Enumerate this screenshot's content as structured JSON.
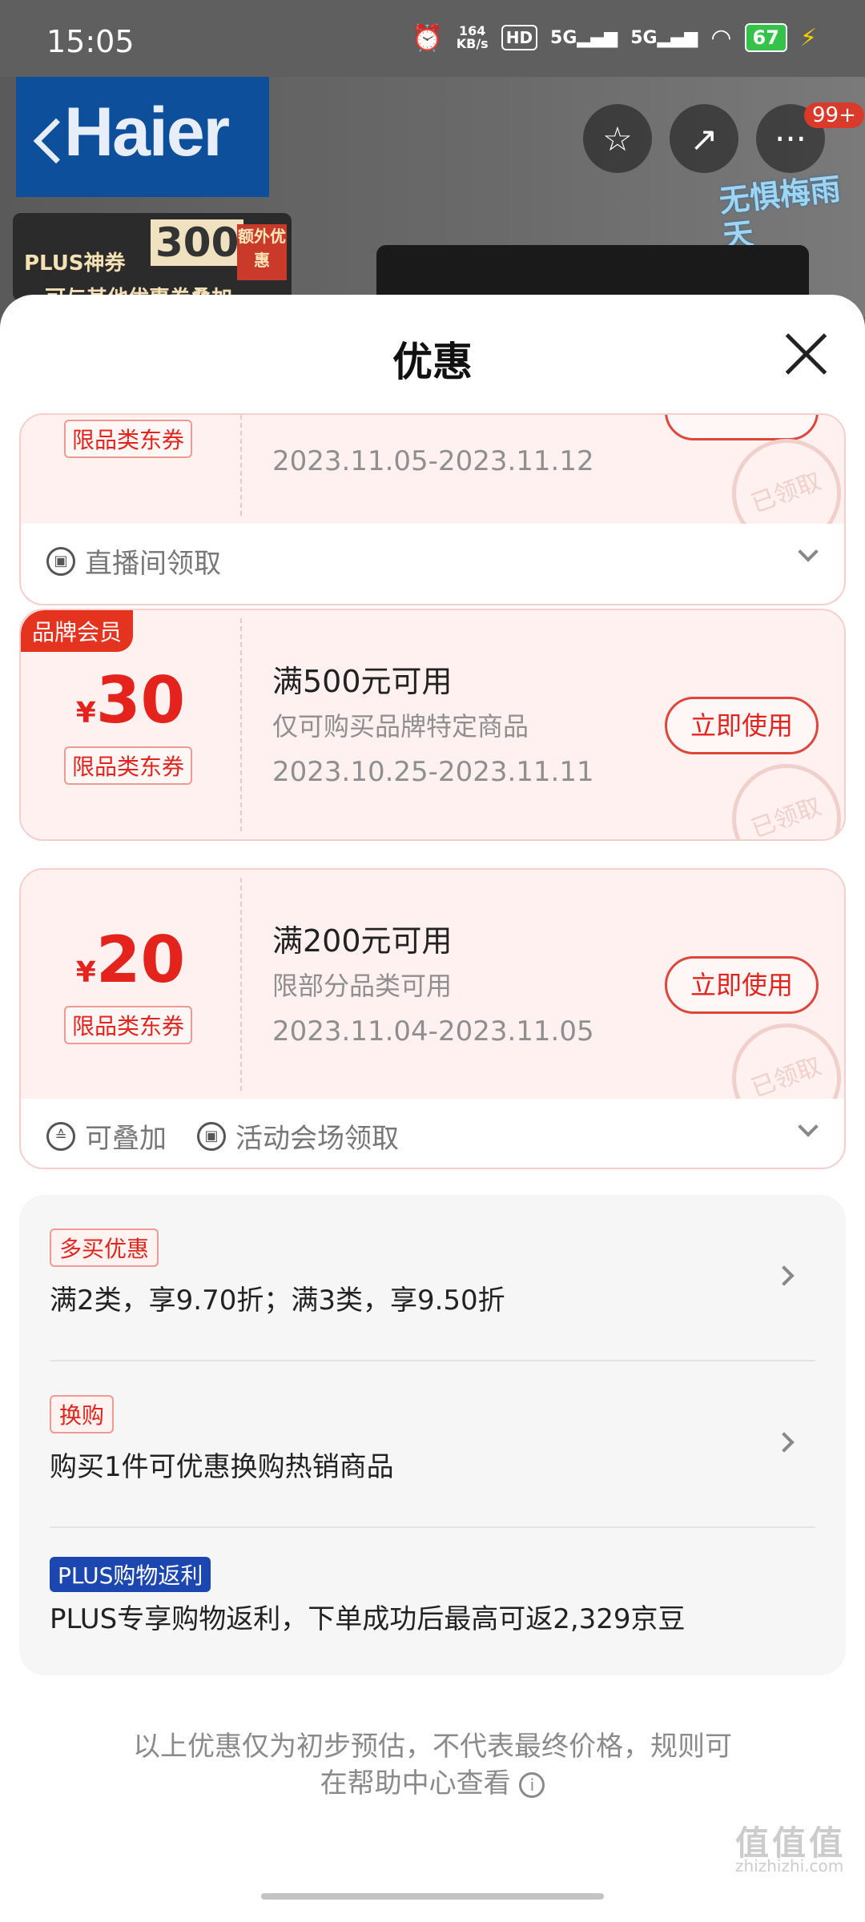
{
  "status_bar": {
    "time": "15:05",
    "net_speed_top": "164",
    "net_speed_bottom": "KB/s",
    "hd_label": "HD",
    "net1": "5G",
    "net2": "5G",
    "battery": "67"
  },
  "banner": {
    "brand": "Haier",
    "plus_label": "PLUS神券",
    "plus_amount": "300",
    "plus_extra": "额外优惠",
    "plus_bottom": "可与其他优惠券叠加",
    "notification_count": "99+",
    "slogan": "无惧梅雨天"
  },
  "sheet": {
    "title": "优惠"
  },
  "coupons": [
    {
      "category_tag": "限品类东券",
      "date": "2023.11.05-2023.11.12",
      "stamp": "已领取",
      "footer": [
        {
          "icon": "live-icon",
          "label": "直播间领取"
        }
      ]
    },
    {
      "member_tag": "品牌会员",
      "currency": "¥",
      "amount": "30",
      "category_tag": "限品类东券",
      "condition": "满500元可用",
      "scope": "仅可购买品牌特定商品",
      "date": "2023.10.25-2023.11.11",
      "button": "立即使用",
      "stamp": "已领取"
    },
    {
      "currency": "¥",
      "amount": "20",
      "category_tag": "限品类东券",
      "condition": "满200元可用",
      "scope": "限部分品类可用",
      "date": "2023.11.04-2023.11.05",
      "button": "立即使用",
      "stamp": "已领取",
      "footer": [
        {
          "icon": "stack-icon",
          "label": "可叠加"
        },
        {
          "icon": "ticket-icon",
          "label": "活动会场领取"
        }
      ]
    }
  ],
  "promotions": [
    {
      "tag": "多买优惠",
      "text": "满2类，享9.70折；满3类，享9.50折"
    },
    {
      "tag": "换购",
      "text": "购买1件可优惠换购热销商品"
    },
    {
      "tag": "PLUS购物返利",
      "text": "PLUS专享购物返利，下单成功后最高可返2,329京豆"
    }
  ],
  "footnote": {
    "line1": "以上优惠仅为初步预估，不代表最终价格，规则可",
    "line2": "在帮助中心查看"
  },
  "watermark": {
    "text": "值值值",
    "sub": "zhizhizhi.com"
  },
  "colors": {
    "accent_red": "#e4241c",
    "plus_blue": "#1d47b0",
    "coupon_bg": "#fff1ef"
  }
}
